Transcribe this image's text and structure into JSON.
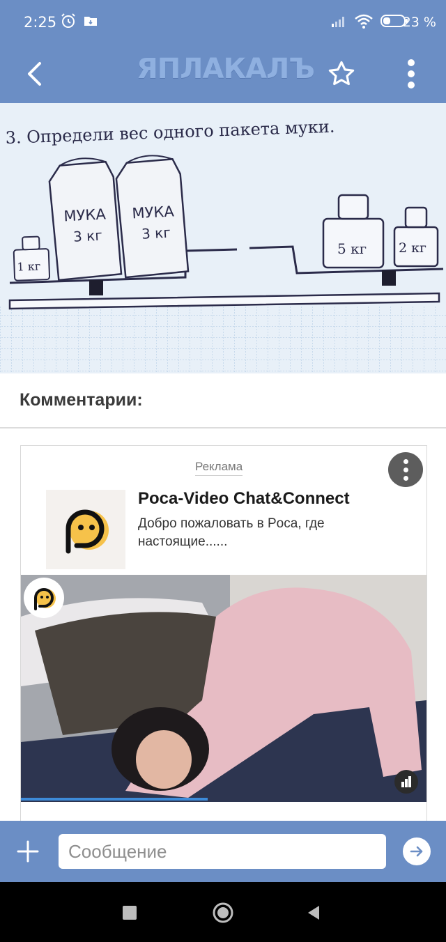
{
  "status_bar": {
    "time": "2:25",
    "battery_percent": "23 %",
    "icons": [
      "alarm-icon",
      "folder-icon",
      "signal-icon",
      "wifi-icon",
      "battery-icon"
    ]
  },
  "toolbar": {
    "logo": "ЯПЛАКАЛЪ",
    "back_icon": "chevron-left-icon",
    "favorite_icon": "star-icon",
    "menu_icon": "more-vertical-icon"
  },
  "post_image": {
    "task": "3. Определи вес одного пакета муки.",
    "bag_label": "МУКА",
    "bag_weight": "3 кг",
    "weights": [
      "1 кг",
      "5 кг",
      "2 кг"
    ]
  },
  "comments": {
    "title": "Комментарии:"
  },
  "ad": {
    "label": "Реклама",
    "title": "Poca-Video Chat&Connect",
    "description": "Добро пожаловать в Poca, где настоящие......",
    "progress": 0.46
  },
  "message_bar": {
    "placeholder": "Сообщение"
  },
  "colors": {
    "accent": "#6b8ec5",
    "logo": "#8fb0e0",
    "progress": "#3d8bd9"
  }
}
